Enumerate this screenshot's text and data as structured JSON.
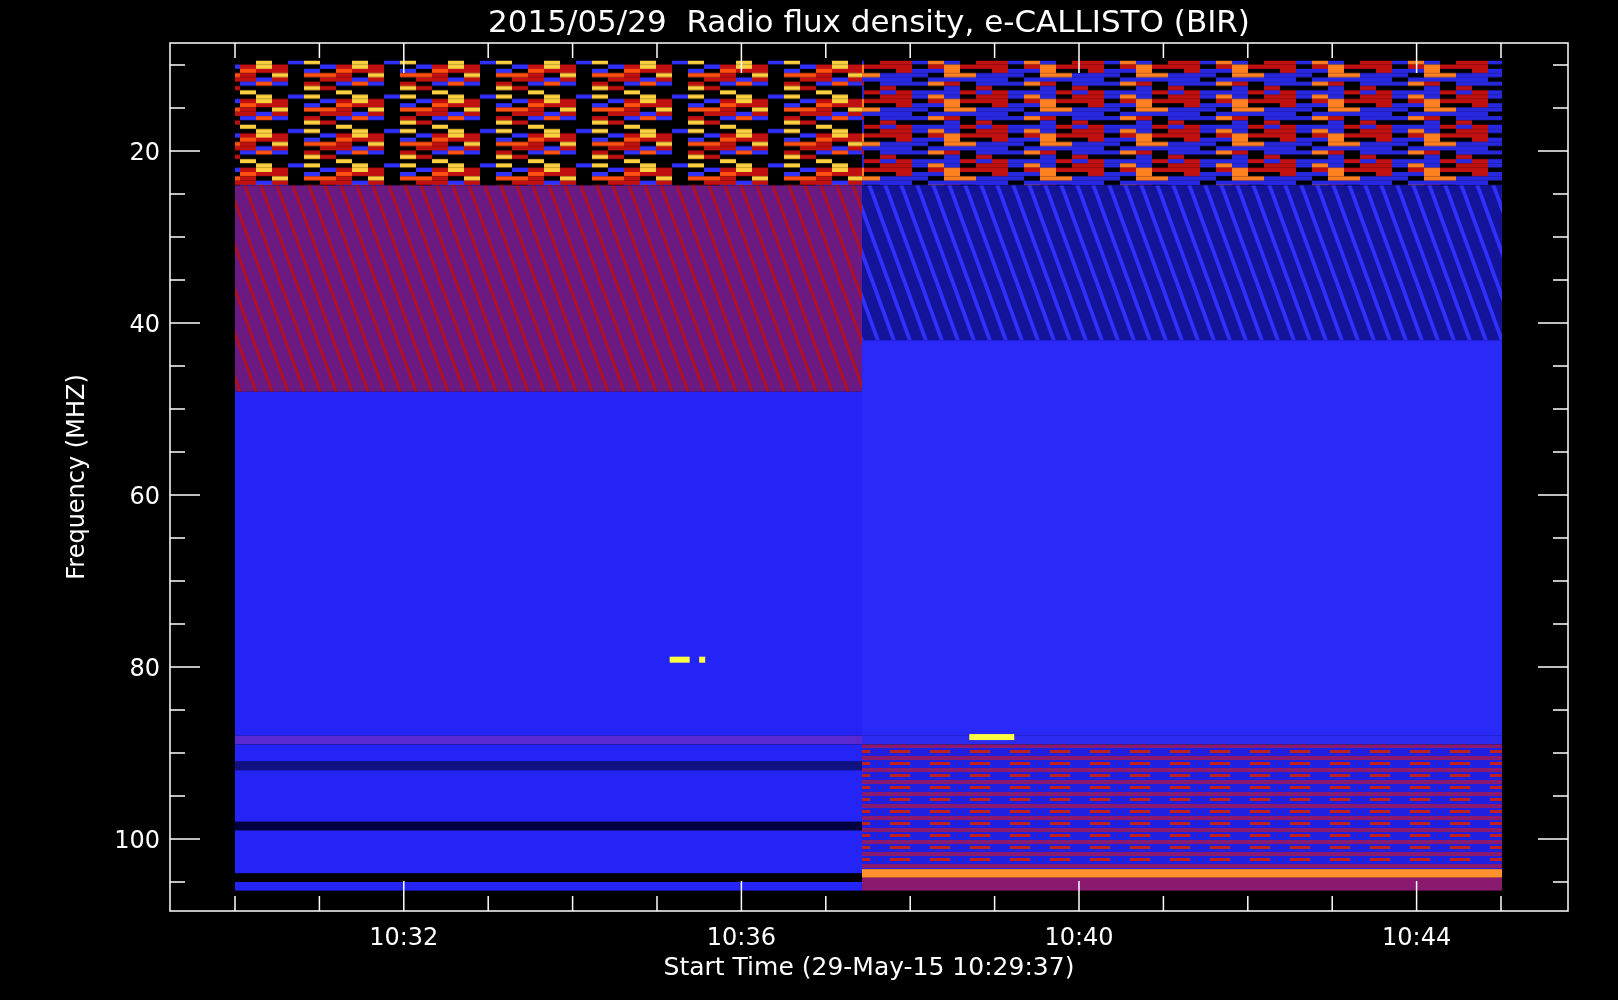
{
  "title": "2015/05/29  Radio flux density, e-CALLISTO (BIR)",
  "ylabel": "Frequency (MHZ)",
  "xlabel": "Start Time (29-May-15 10:29:37)",
  "yticks": [
    "20",
    "40",
    "60",
    "80",
    "100"
  ],
  "xticks": [
    "10:32",
    "10:36",
    "10:40",
    "10:44"
  ]
}
